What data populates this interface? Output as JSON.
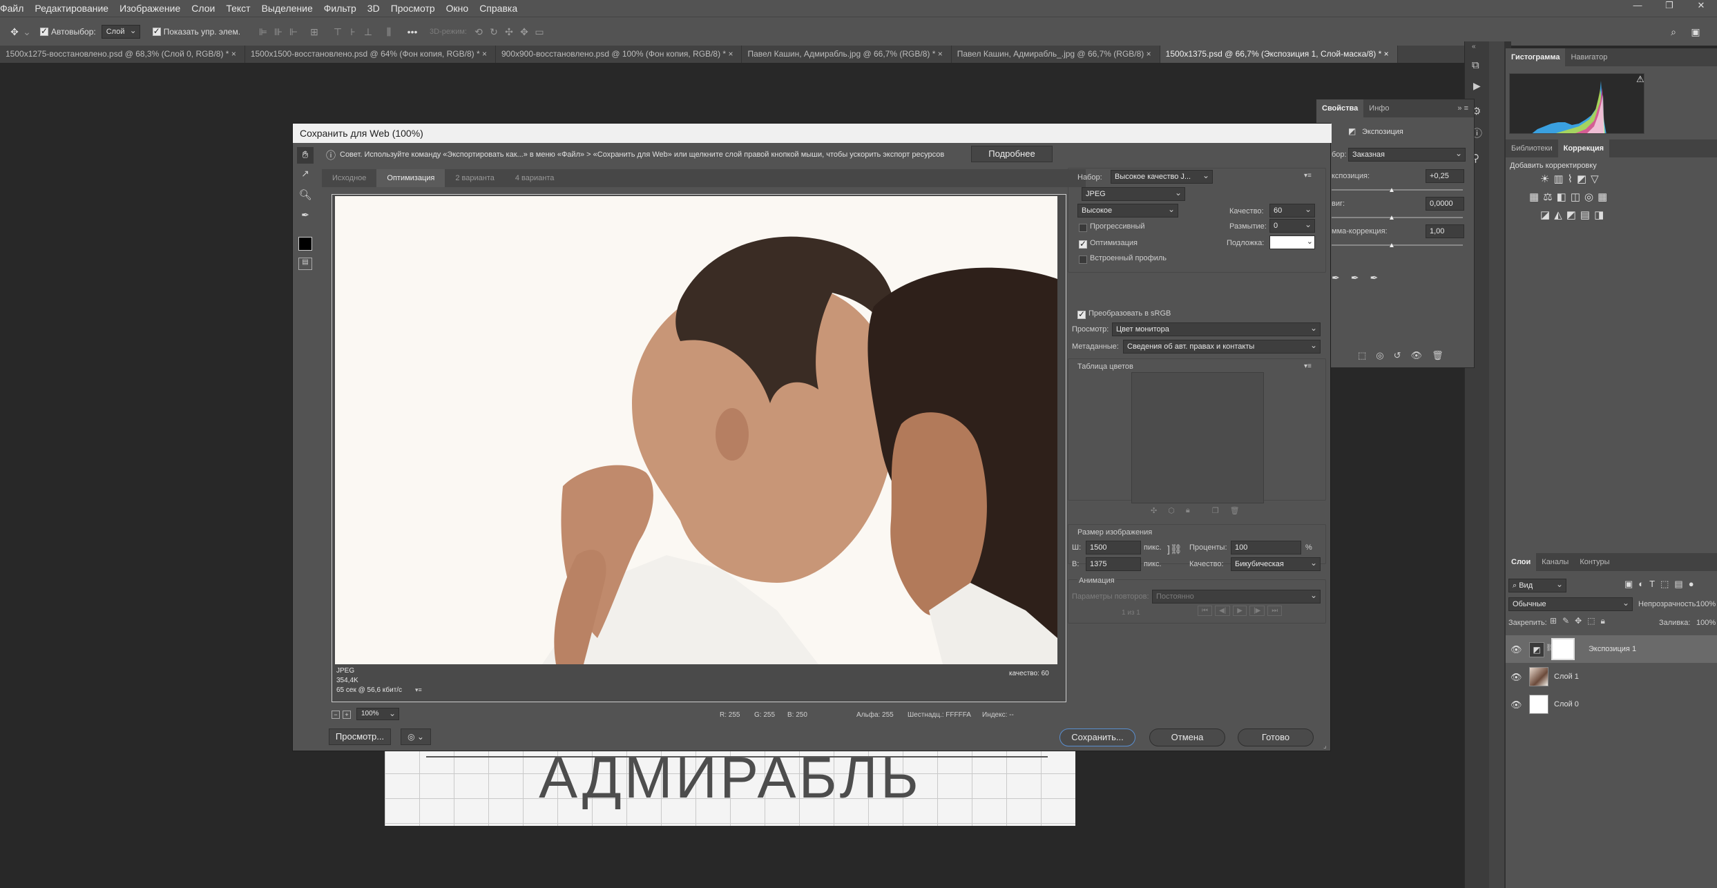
{
  "menu": {
    "items": [
      "Файл",
      "Редактирование",
      "Изображение",
      "Слои",
      "Текст",
      "Выделение",
      "Фильтр",
      "3D",
      "Просмотр",
      "Окно",
      "Справка"
    ]
  },
  "options": {
    "auto_select_label": "Автовыбор:",
    "auto_select_value": "Слой",
    "show_controls_label": "Показать упр. элем.",
    "mode_3d": "3D-режим:"
  },
  "tabs": [
    {
      "label": "1500x1275-восстановлено.psd @ 68,3% (Слой 0, RGB/8) *"
    },
    {
      "label": "1500x1500-восстановлено.psd @ 64% (Фон копия, RGB/8) *"
    },
    {
      "label": "900x900-восстановлено.psd @ 100% (Фон копия, RGB/8) *"
    },
    {
      "label": "Павел Кашин, Адмирабль.jpg @ 66,7% (RGB/8) *"
    },
    {
      "label": "Павел Кашин, Адмирабль_.jpg @ 66,7% (RGB/8)"
    },
    {
      "label": "1500x1375.psd @ 66,7% (Экспозиция 1, Слой-маска/8) *"
    }
  ],
  "document": {
    "visible_text": "АДМИРАБЛЬ"
  },
  "dialog": {
    "title": "Сохранить для Web (100%)",
    "tip": "Совет. Используйте команду «Экспортировать как...» в меню «Файл» > «Сохранить для Web» или щелкните слой правой кнопкой мыши, чтобы ускорить экспорт ресурсов",
    "more_button": "Подробнее",
    "view_tabs": [
      "Исходное",
      "Оптимизация",
      "2 варианта",
      "4 варианта"
    ],
    "preview_info": {
      "format": "JPEG",
      "size": "354,4K",
      "time": "65 сек @ 56,6 кбит/с",
      "quality": "качество: 60"
    },
    "zoom": "100%",
    "status": {
      "r": "R: 255",
      "g": "G: 255",
      "b": "B: 250",
      "alpha": "Альфа: 255",
      "hex": "Шестнадц.: FFFFFA",
      "index": "Индекс: --"
    },
    "preview_button": "Просмотр...",
    "save_button": "Сохранить...",
    "cancel_button": "Отмена",
    "done_button": "Готово",
    "settings": {
      "preset_label": "Набор:",
      "preset_value": "Высокое качество J...",
      "format": "JPEG",
      "quality_preset": "Высокое",
      "quality_label": "Качество:",
      "quality_value": "60",
      "blur_label": "Размытие:",
      "blur_value": "0",
      "matte_label": "Подложка:",
      "progressive": "Прогрессивный",
      "optimized": "Оптимизация",
      "embed_profile": "Встроенный профиль",
      "convert_srgb": "Преобразовать в sRGB",
      "preview_label": "Просмотр:",
      "preview_value": "Цвет монитора",
      "metadata_label": "Метаданные:",
      "metadata_value": "Сведения об авт. правах и контакты",
      "color_table": "Таблица цветов",
      "image_size": "Размер изображения",
      "w_label": "Ш:",
      "w_value": "1500",
      "h_label": "В:",
      "h_value": "1375",
      "px": "пикс.",
      "percent_label": "Проценты:",
      "percent_value": "100",
      "pct": "%",
      "quality2_label": "Качество:",
      "quality2_value": "Бикубическая",
      "animation": "Анимация",
      "loop_label": "Параметры повторов:",
      "loop_value": "Постоянно",
      "frame_count": "1 из 1"
    }
  },
  "properties": {
    "tabs": [
      "Свойства",
      "Инфо"
    ],
    "title": "Экспозиция",
    "preset_label": "бор:",
    "preset_value": "Заказная",
    "exposure_label": "кспозиция:",
    "exposure_value": "+0,25",
    "offset_label": "виг:",
    "offset_value": "0,0000",
    "gamma_label": "мма-коррекция:",
    "gamma_value": "1,00"
  },
  "right": {
    "top_tabs": [
      "Гистограмма",
      "Навигатор"
    ],
    "mid_tabs": [
      "Библиотеки",
      "Коррекция"
    ],
    "add_correction": "Добавить корректировку",
    "layer_tabs": [
      "Слои",
      "Каналы",
      "Контуры"
    ],
    "kind": "Вид",
    "blend": "Обычные",
    "opacity_label": "Непрозрачность:",
    "opacity_value": "100%",
    "lock_label": "Закрепить:",
    "fill_label": "Заливка:",
    "fill_value": "100%",
    "layers": [
      {
        "name": "Экспозиция 1"
      },
      {
        "name": "Слой 1"
      },
      {
        "name": "Слой 0"
      }
    ]
  }
}
